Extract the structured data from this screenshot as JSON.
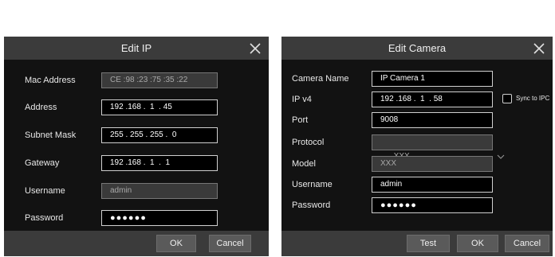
{
  "edit_ip": {
    "title": "Edit  IP",
    "mac_label": "Mac Address",
    "mac_value": "CE :98 :23 :75 :35 :22",
    "address_label": "Address",
    "address_value": "192 .168 .  1  . 45",
    "subnet_label": "Subnet Mask",
    "subnet_value": "255 . 255 . 255 .  0",
    "gateway_label": "Gateway",
    "gateway_value": "192 .168 .  1  .  1",
    "username_label": "Username",
    "username_value": "admin",
    "password_label": "Password",
    "password_value": "●●●●●●",
    "ok_label": "OK",
    "cancel_label": "Cancel"
  },
  "edit_camera": {
    "title": "Edit  Camera",
    "camera_name_label": "Camera Name",
    "camera_name_value": "IP Camera 1",
    "ipv4_label": "IP v4",
    "ipv4_value": "192 .168 .  1  . 58",
    "sync_label": "Sync to IPC",
    "sync_checked": false,
    "port_label": "Port",
    "port_value": "9008",
    "protocol_label": "Protocol",
    "protocol_value": "XXX",
    "model_label": "Model",
    "model_value": "XXX",
    "username_label": "Username",
    "username_value": "admin",
    "password_label": "Password",
    "password_value": "●●●●●●",
    "test_label": "Test",
    "ok_label": "OK",
    "cancel_label": "Cancel"
  },
  "icons": {
    "close": "close-icon",
    "dropdown": "chevron-down-icon"
  }
}
